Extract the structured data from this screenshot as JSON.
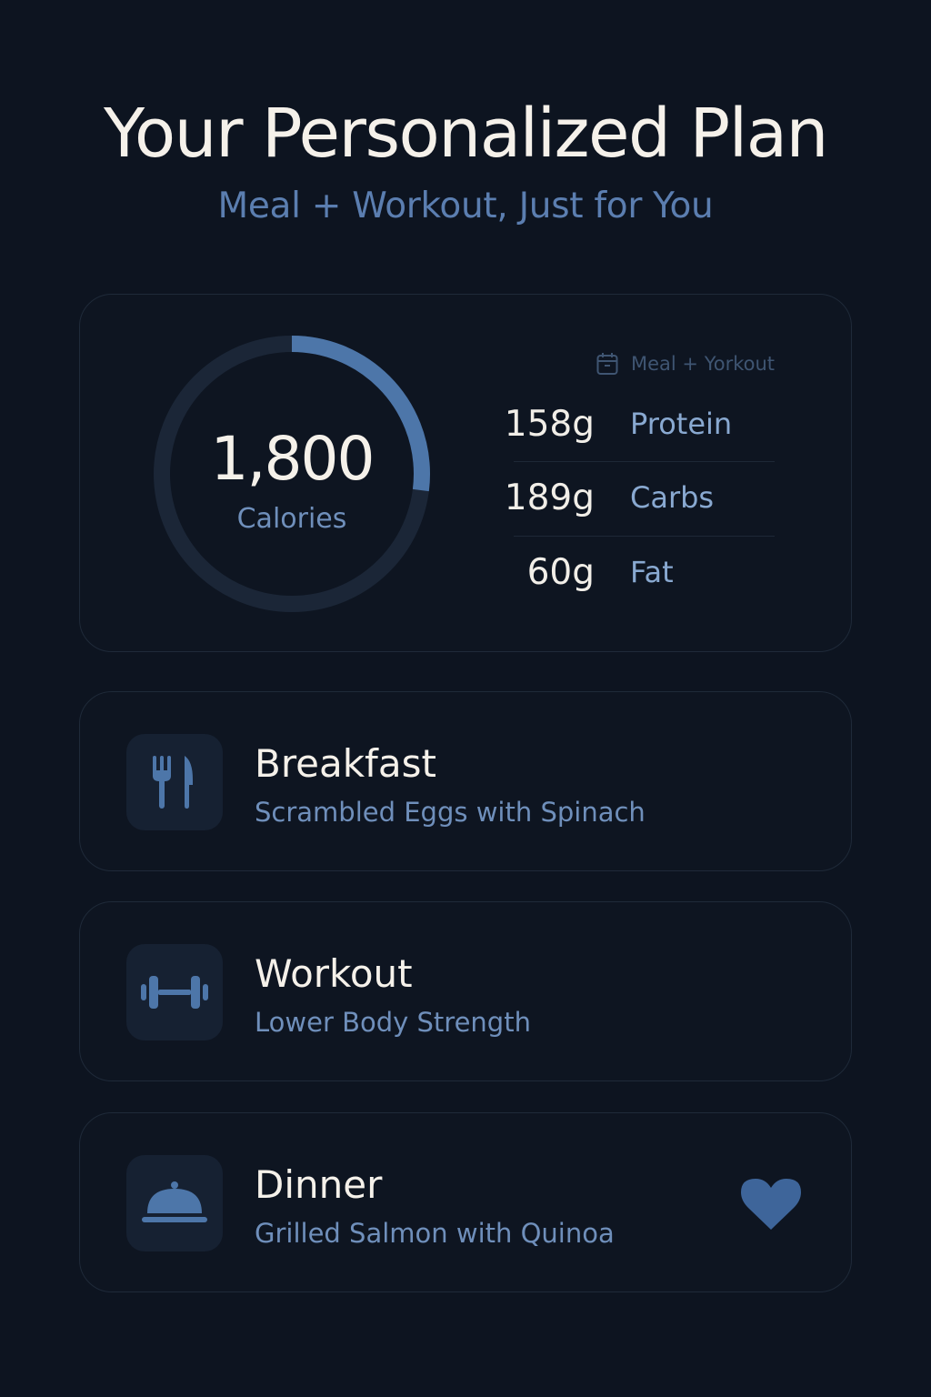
{
  "header": {
    "title": "Your Personalized Plan",
    "subtitle": "Meal + Workout, Just for You"
  },
  "summary": {
    "calories_value": "1,800",
    "calories_label": "Calories",
    "calorie_progress": 0.27,
    "plan_tag": "Meal + Yorkout",
    "plan_tag_icon": "calendar-icon",
    "macros": [
      {
        "value": "158g",
        "name": "Protein"
      },
      {
        "value": "189g",
        "name": "Carbs"
      },
      {
        "value": "60g",
        "name": "Fat"
      }
    ]
  },
  "items": [
    {
      "title": "Breakfast",
      "subtitle": "Scrambled Eggs with Spinach",
      "icon": "fork-knife-icon"
    },
    {
      "title": "Workout",
      "subtitle": "Lower Body Strength",
      "icon": "dumbbell-icon"
    },
    {
      "title": "Dinner",
      "subtitle": "Grilled Salmon with Quinoa",
      "icon": "cloche-icon",
      "favorite_icon": "heart-icon"
    }
  ],
  "colors": {
    "background": "#0d1420",
    "accent": "#4d76a9",
    "ring_track": "#1b2637",
    "text_primary": "#f5f1ea",
    "text_secondary": "#6f8fbb"
  }
}
